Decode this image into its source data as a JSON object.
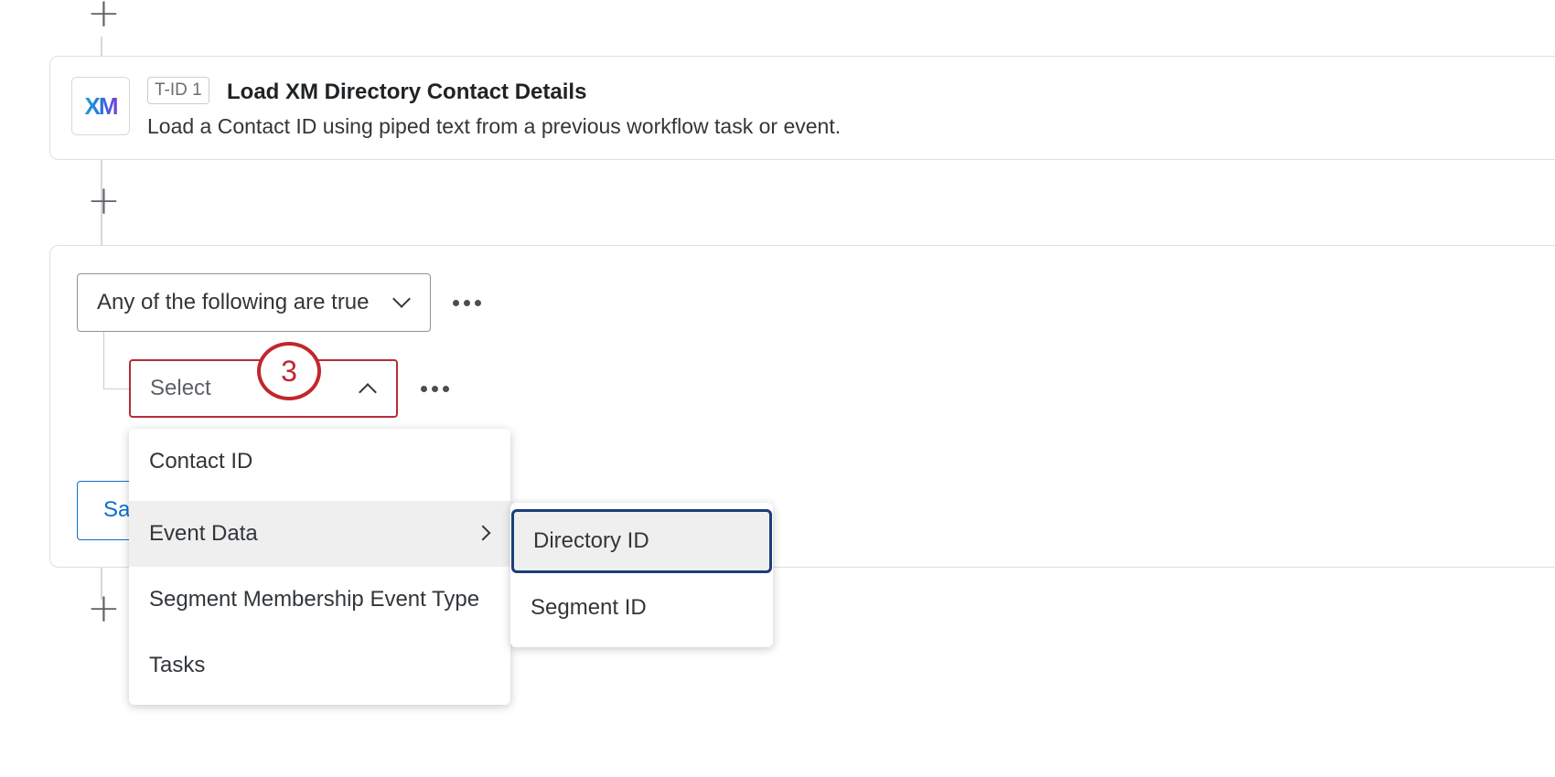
{
  "task": {
    "logo_text": "XM",
    "id_badge": "T-ID 1",
    "title": "Load XM Directory Contact Details",
    "description": "Load a Contact ID using piped text from a previous workflow task or event."
  },
  "condition": {
    "match_mode": "Any of the following are true",
    "field_placeholder": "Select",
    "save_label": "Sa"
  },
  "step_marker": "3",
  "field_menu": {
    "items": [
      {
        "label": "Contact ID"
      },
      {
        "label": "Event Data"
      },
      {
        "label": "Segment Membership Event Type"
      },
      {
        "label": "Tasks"
      }
    ],
    "active_item": "Event Data"
  },
  "event_data_submenu": {
    "items": [
      {
        "label": "Directory ID"
      },
      {
        "label": "Segment ID"
      }
    ],
    "focused_item": "Directory ID"
  },
  "icons": [
    "plus-icon",
    "more-options-icon",
    "chevron-down-icon",
    "chevron-up-icon",
    "chevron-right-icon"
  ],
  "colors": {
    "error_border": "#b52d37",
    "step_marker": "#c1272d",
    "link_blue": "#0b6fd1",
    "focus_ring": "#1a3e7a"
  }
}
